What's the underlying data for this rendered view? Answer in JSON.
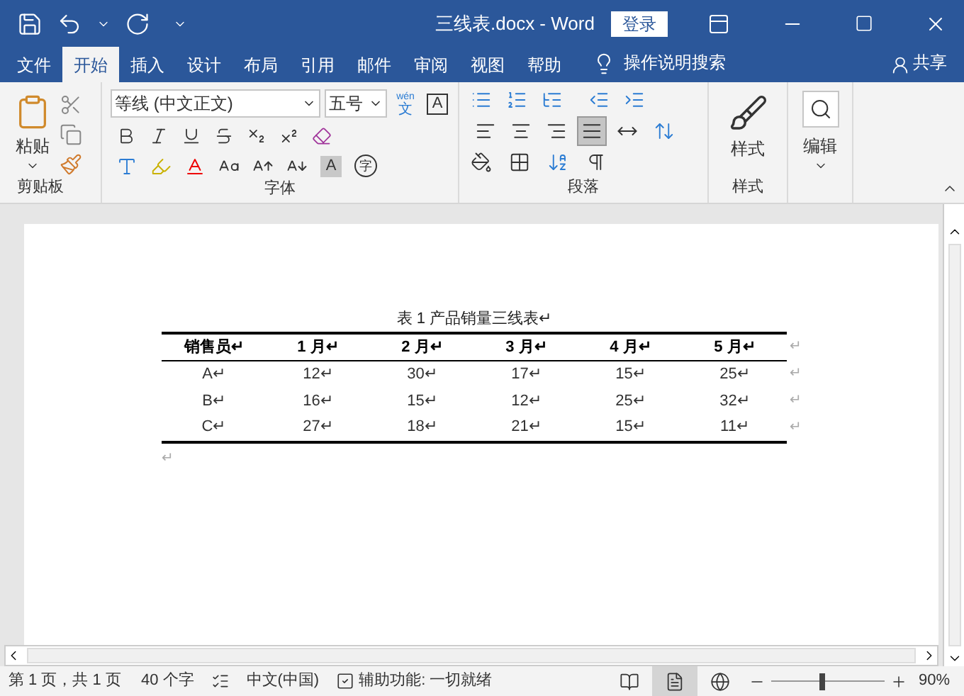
{
  "title_bar": {
    "title": "三线表.docx  -  Word",
    "login": "登录"
  },
  "tabs": [
    {
      "label": "文件",
      "selected": false
    },
    {
      "label": "开始",
      "selected": true
    },
    {
      "label": "插入",
      "selected": false
    },
    {
      "label": "设计",
      "selected": false
    },
    {
      "label": "布局",
      "selected": false
    },
    {
      "label": "引用",
      "selected": false
    },
    {
      "label": "邮件",
      "selected": false
    },
    {
      "label": "审阅",
      "selected": false
    },
    {
      "label": "视图",
      "selected": false
    },
    {
      "label": "帮助",
      "selected": false
    }
  ],
  "tell_me": "操作说明搜索",
  "share": "共享",
  "ribbon": {
    "paste": "粘贴",
    "clipboard_label": "剪贴板",
    "font_name": "等线 (中文正文)",
    "font_size": "五号",
    "phonetic_top": "wén",
    "phonetic_bottom": "文",
    "char_border": "A",
    "char_shading": "A",
    "enclose_char": "字",
    "font_label": "字体",
    "align": [
      {
        "kind": "left",
        "selected": false
      },
      {
        "kind": "center",
        "selected": false
      },
      {
        "kind": "right",
        "selected": false
      },
      {
        "kind": "justify",
        "selected": true
      },
      {
        "kind": "distributed",
        "selected": false
      }
    ],
    "paragraph_label": "段落",
    "styles": "样式",
    "styles_label": "样式",
    "editing": "编辑"
  },
  "document": {
    "caption": "表 1  产品销量三线表↵",
    "columns": [
      "销售员↵",
      "1 月↵",
      "2 月↵",
      "3 月↵",
      "4 月↵",
      "5 月↵"
    ],
    "rows": [
      [
        "A↵",
        "12↵",
        "30↵",
        "17↵",
        "15↵",
        "25↵"
      ],
      [
        "B↵",
        "16↵",
        "15↵",
        "12↵",
        "25↵",
        "32↵"
      ],
      [
        "C↵",
        "27↵",
        "18↵",
        "21↵",
        "15↵",
        "11↵"
      ]
    ],
    "row_ends": [
      "↵",
      "↵",
      "↵",
      "↵"
    ],
    "after": "↵"
  },
  "status_bar": {
    "page": "第 1 页，共 1 页",
    "words": "40 个字",
    "language": "中文(中国)",
    "accessibility": "辅助功能: 一切就绪",
    "views": [
      {
        "kind": "read",
        "selected": false
      },
      {
        "kind": "print",
        "selected": true
      },
      {
        "kind": "web",
        "selected": false
      }
    ],
    "zoom": {
      "level": 0.45,
      "reading": "90%"
    }
  }
}
